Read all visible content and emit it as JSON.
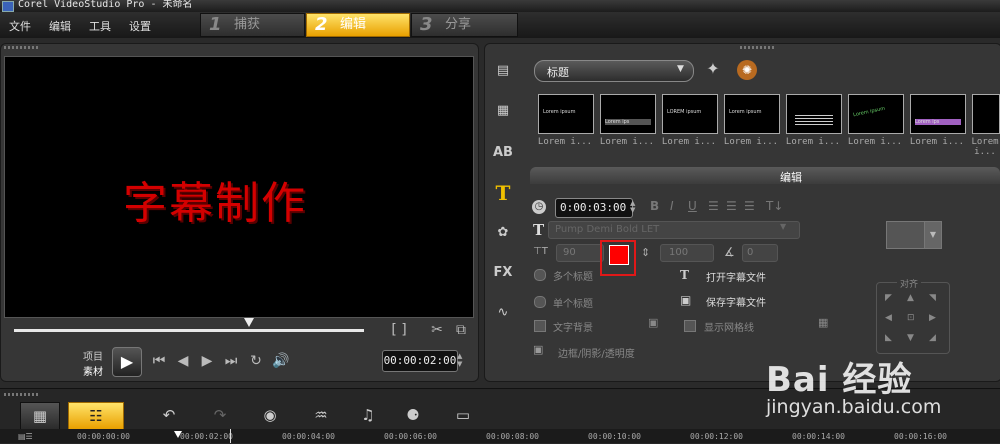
{
  "window": {
    "title": "Corel VideoStudio Pro - 未命名"
  },
  "menu": {
    "items": [
      "文件",
      "编辑",
      "工具",
      "设置"
    ]
  },
  "steps": [
    {
      "num": "1",
      "label": "捕获"
    },
    {
      "num": "2",
      "label": "编辑"
    },
    {
      "num": "3",
      "label": "分享"
    }
  ],
  "preview": {
    "title_text": "字幕制作",
    "mode_project": "项目",
    "mode_clip": "素材",
    "timecode": "00:00:02:00",
    "trim_brackets": "[ ]"
  },
  "library": {
    "category": "标题",
    "thumbnails": [
      {
        "caption": "Lorem i...",
        "text": "Lorem ipsum"
      },
      {
        "caption": "Lorem i...",
        "text": "Lorem ips"
      },
      {
        "caption": "Lorem i...",
        "text": "LOREM ipsum"
      },
      {
        "caption": "Lorem i...",
        "text": "Lorem ipsum"
      },
      {
        "caption": "Lorem i...",
        "text": ""
      },
      {
        "caption": "Lorem i...",
        "text": "Lorem ipsum"
      },
      {
        "caption": "Lorem i...",
        "text": "Lorem ips"
      },
      {
        "caption": "Lorem i...",
        "text": ""
      }
    ]
  },
  "edit": {
    "tab_label": "编辑",
    "duration": "0:00:03:00",
    "font_name": "Pump Demi Bold LET",
    "font_size": "90",
    "line_spacing": "100",
    "rotation": "0",
    "text_color": "#ff0000",
    "multi_title": "多个标题",
    "single_title": "单个标题",
    "open_subtitle": "打开字幕文件",
    "save_subtitle": "保存字幕文件",
    "text_background": "文字背景",
    "show_grid": "显示网格线",
    "border_shadow": "边框/阴影/透明度",
    "align_label": "对齐",
    "style_buttons": [
      "B",
      "I",
      "U"
    ]
  },
  "timeline": {
    "timecodes": [
      "00:00:00:00",
      "00:00:02:00",
      "00:00:04:00",
      "00:00:06:00",
      "00:00:08:00",
      "00:00:10:00",
      "00:00:12:00",
      "00:00:14:00",
      "00:00:16:00"
    ]
  },
  "watermark": {
    "brand": "Bai 经验",
    "url": "jingyan.baidu.com"
  }
}
